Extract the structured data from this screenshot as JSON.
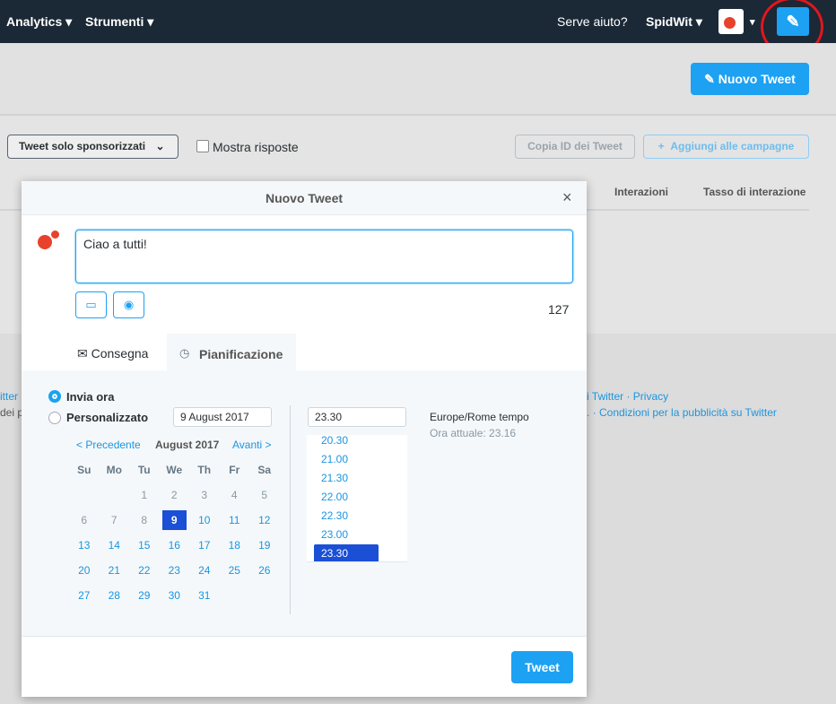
{
  "nav": {
    "analytics": "Analytics",
    "tools": "Strumenti",
    "help": "Serve aiuto?",
    "account": "SpidWit"
  },
  "header": {
    "new_tweet": "Nuovo Tweet"
  },
  "toolbar": {
    "filter": "Tweet solo sponsorizzati",
    "show_replies": "Mostra risposte",
    "copy_id": "Copia ID dei Tweet",
    "add_campaigns": "Aggiungi alle campagne"
  },
  "table": {
    "col_interactions": "Interazioni",
    "col_rate": "Tasso di interazione"
  },
  "footer": {
    "l1": "itter",
    "l2": "dei p",
    "r1a": "i Twitter",
    "r1b": "Privacy",
    "r2a": ".",
    "r2b": "Condizioni per la pubblicità su Twitter"
  },
  "modal": {
    "title": "Nuovo Tweet",
    "text": "Ciao a tutti!",
    "char_count": "127",
    "tabs": [
      {
        "label": "Consegna"
      },
      {
        "label": "Pianificazione"
      }
    ],
    "send_now": "Invia ora",
    "custom": "Personalizzato",
    "date": "9 August 2017",
    "time": "23.30",
    "prev": "< Precedente",
    "month": "August 2017",
    "next": "Avanti >",
    "weekdays": [
      "Su",
      "Mo",
      "Tu",
      "We",
      "Th",
      "Fr",
      "Sa"
    ],
    "days": [
      [
        "",
        "",
        "1",
        "2",
        "3",
        "4",
        "5"
      ],
      [
        "6",
        "7",
        "8",
        "9",
        "10",
        "11",
        "12"
      ],
      [
        "13",
        "14",
        "15",
        "16",
        "17",
        "18",
        "19"
      ],
      [
        "20",
        "21",
        "22",
        "23",
        "24",
        "25",
        "26"
      ],
      [
        "27",
        "28",
        "29",
        "30",
        "31",
        "",
        ""
      ]
    ],
    "selected_day": "9",
    "times": [
      "20.30",
      "21.00",
      "21.30",
      "22.00",
      "22.30",
      "23.00",
      "23.30"
    ],
    "selected_time": "23.30",
    "timezone": "Europe/Rome tempo",
    "current_time": "Ora attuale: 23.16",
    "tweet_button": "Tweet"
  },
  "colors": {
    "accent": "#1da1f2",
    "nav": "#1b2836",
    "selected": "#1a4fd6"
  }
}
